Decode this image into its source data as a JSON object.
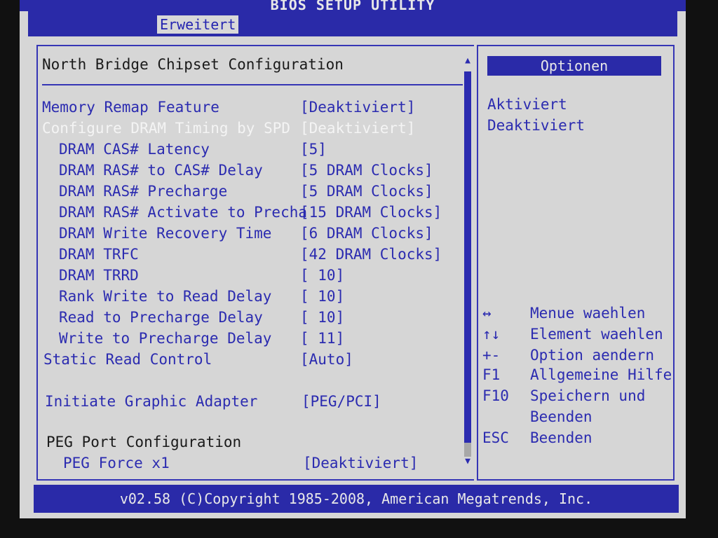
{
  "header": {
    "title": "BIOS SETUP UTILITY",
    "active_tab": "Erweitert"
  },
  "main": {
    "section_title": "North Bridge Chipset Configuration",
    "rows": [
      {
        "label": "Memory Remap Feature",
        "value": "[Deaktiviert]"
      },
      {
        "label": "Configure DRAM Timing by SPD",
        "value": "[Deaktiviert]"
      },
      {
        "label": "DRAM CAS# Latency",
        "value": "[5]"
      },
      {
        "label": "DRAM RAS# to CAS# Delay",
        "value": "[5 DRAM Clocks]"
      },
      {
        "label": "DRAM RAS# Precharge",
        "value": "[5 DRAM Clocks]"
      },
      {
        "label": "DRAM RAS# Activate to Precha",
        "value": "[15 DRAM Clocks]"
      },
      {
        "label": "DRAM Write Recovery Time",
        "value": "[6 DRAM Clocks]"
      },
      {
        "label": "DRAM TRFC",
        "value": "[42 DRAM Clocks]"
      },
      {
        "label": "DRAM TRRD",
        "value": "[ 10]"
      },
      {
        "label": "Rank Write to Read Delay",
        "value": "[ 10]"
      },
      {
        "label": "Read to Precharge Delay",
        "value": "[ 10]"
      },
      {
        "label": "Write to Precharge Delay",
        "value": "[ 11]"
      },
      {
        "label": "Static Read Control",
        "value": "[Auto]"
      },
      {
        "label": "Initiate Graphic Adapter",
        "value": "[PEG/PCI]"
      },
      {
        "label": "PEG Port Configuration",
        "value": ""
      },
      {
        "label": "PEG Force x1",
        "value": "[Deaktiviert]"
      }
    ]
  },
  "options": {
    "header": "Optionen",
    "items": [
      "Aktiviert",
      "Deaktiviert"
    ]
  },
  "help": [
    {
      "key": "↔",
      "desc": "Menue waehlen"
    },
    {
      "key": "↑↓",
      "desc": "Element waehlen"
    },
    {
      "key": "+-",
      "desc": "Option aendern"
    },
    {
      "key": "F1",
      "desc": "Allgemeine Hilfe"
    },
    {
      "key": "F10",
      "desc": "Speichern und"
    },
    {
      "key": "",
      "desc": "Beenden"
    },
    {
      "key": "ESC",
      "desc": "Beenden"
    }
  ],
  "footer": {
    "text": "v02.58 (C)Copyright 1985-2008, American Megatrends, Inc."
  },
  "colors": {
    "bios_blue": "#2a2aa8",
    "panel_gray": "#d6d6d6",
    "highlight_white": "#f4f4f4"
  }
}
